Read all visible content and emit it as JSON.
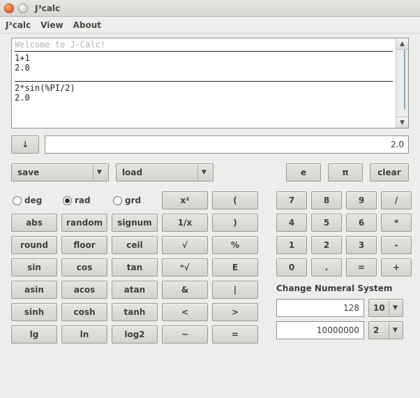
{
  "window": {
    "title": "J³calc"
  },
  "menu": {
    "items": [
      "J³calc",
      "View",
      "About"
    ]
  },
  "history": {
    "faded_line": "Welcome to J-Calc!",
    "blocks": [
      {
        "expr": "1+1",
        "result": "2.0"
      },
      {
        "expr": "2*sin(%PI/2)",
        "result": "2.0"
      }
    ]
  },
  "result_row": {
    "down_label": "↓",
    "value": "2.0"
  },
  "toprow": {
    "save": "save",
    "load": "load",
    "e": "e",
    "pi": "π",
    "clear": "clear"
  },
  "angle": {
    "deg": "deg",
    "rad": "rad",
    "grd": "grd",
    "selected": "rad"
  },
  "func_grid": [
    [
      "abs",
      "random",
      "signum",
      "1/x",
      ")"
    ],
    [
      "round",
      "floor",
      "ceil",
      "√",
      "%"
    ],
    [
      "sin",
      "cos",
      "tan",
      "ⁿ√",
      "E"
    ],
    [
      "asin",
      "acos",
      "atan",
      "&",
      "|"
    ],
    [
      "sinh",
      "cosh",
      "tanh",
      "<",
      ">"
    ],
    [
      "lg",
      "ln",
      "log2",
      "~",
      "="
    ]
  ],
  "func_row0_right": [
    "x²",
    "("
  ],
  "numpad": [
    [
      "7",
      "8",
      "9",
      "/"
    ],
    [
      "4",
      "5",
      "6",
      "*"
    ],
    [
      "1",
      "2",
      "3",
      "-"
    ],
    [
      "0",
      ".",
      "=",
      "+"
    ]
  ],
  "numsys": {
    "label": "Change Numeral System",
    "in_value": "128",
    "in_base": "10",
    "out_value": "10000000",
    "out_base": "2"
  }
}
